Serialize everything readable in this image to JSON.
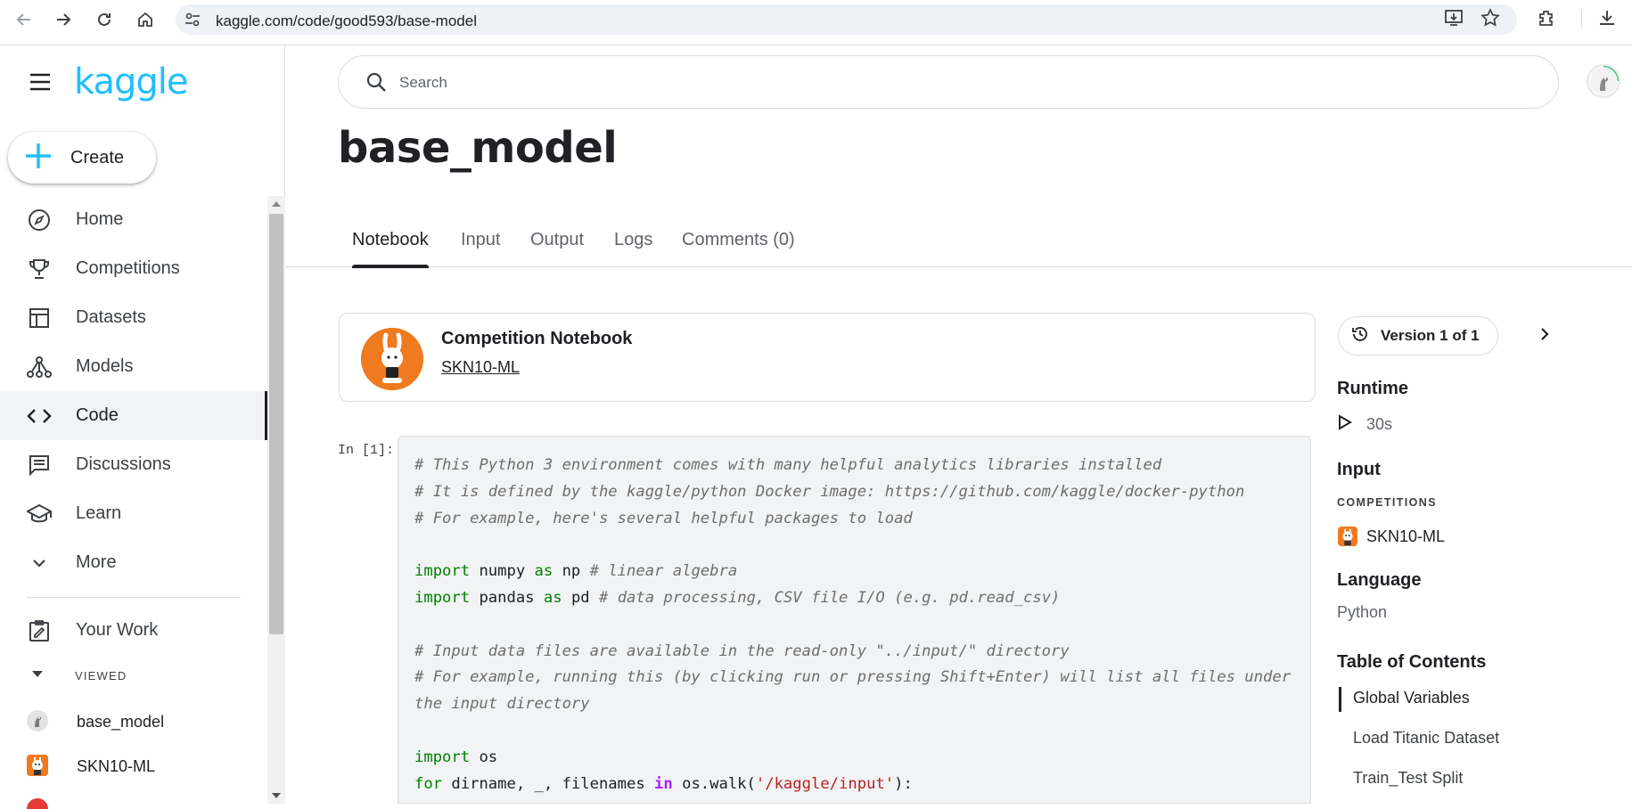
{
  "browser": {
    "url": "kaggle.com/code/good593/base-model"
  },
  "sidebar": {
    "logo": "kaggle",
    "create_label": "Create",
    "items": [
      {
        "label": "Home",
        "icon": "compass-icon"
      },
      {
        "label": "Competitions",
        "icon": "trophy-icon"
      },
      {
        "label": "Datasets",
        "icon": "table-icon"
      },
      {
        "label": "Models",
        "icon": "models-icon"
      },
      {
        "label": "Code",
        "icon": "code-icon",
        "active": true
      },
      {
        "label": "Discussions",
        "icon": "discussion-icon"
      },
      {
        "label": "Learn",
        "icon": "school-icon"
      },
      {
        "label": "More",
        "icon": "chevron-down-icon"
      }
    ],
    "your_work": "Your Work",
    "viewed_header": "VIEWED",
    "recent": [
      {
        "label": "base_model"
      },
      {
        "label": "SKN10-ML"
      }
    ]
  },
  "search": {
    "placeholder": "Search"
  },
  "page": {
    "title": "base_model",
    "tabs": [
      "Notebook",
      "Input",
      "Output",
      "Logs",
      "Comments (0)"
    ],
    "active_tab": "Notebook"
  },
  "competition_card": {
    "label": "Competition Notebook",
    "link": "SKN10-ML"
  },
  "cell": {
    "label": "In [1]:",
    "lines": [
      "# This Python 3 environment comes with many helpful analytics libraries installed",
      "# It is defined by the kaggle/python Docker image: https://github.com/kaggle/docker-python",
      "# For example, here's several helpful packages to load",
      "",
      "import numpy as np # linear algebra",
      "import pandas as pd # data processing, CSV file I/O (e.g. pd.read_csv)",
      "",
      "# Input data files are available in the read-only \"../input/\" directory",
      "# For example, running this (by clicking run or pressing Shift+Enter) will list all files under",
      "the input directory",
      "",
      "import os",
      "for dirname, _, filenames in os.walk('/kaggle/input'):"
    ]
  },
  "right_panel": {
    "version_label": "Version 1 of 1",
    "runtime_header": "Runtime",
    "runtime_value": "30s",
    "input_header": "Input",
    "competitions_header": "COMPETITIONS",
    "competition_name": "SKN10-ML",
    "language_header": "Language",
    "language_value": "Python",
    "toc_header": "Table of Contents",
    "toc": [
      "Global Variables",
      "Load Titanic Dataset",
      "Train_Test Split"
    ]
  },
  "colors": {
    "brand": "#20beff",
    "accent_orange": "#f07a1f"
  }
}
